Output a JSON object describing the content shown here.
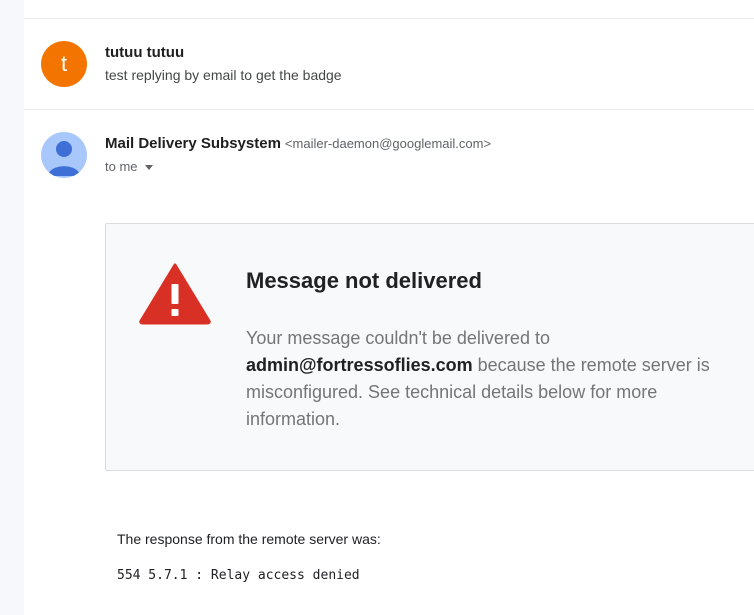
{
  "thread": {
    "previous_message": {
      "avatar_letter": "t",
      "avatar_color": "#f37500",
      "sender": "tutuu tutuu",
      "snippet": "test replying by email to get the badge"
    },
    "message": {
      "sender_name": "Mail Delivery Subsystem",
      "sender_email": "<mailer-daemon@googlemail.com>",
      "recipients": "to me",
      "avatar_icon": "default-user-icon"
    }
  },
  "bounce": {
    "icon": "warning-icon",
    "title": "Message not delivered",
    "body_prefix": "Your message couldn't be delivered to ",
    "email": "admin@fortressoflies.com",
    "body_suffix": " because the remote server is misconfigured. See technical details below for more information."
  },
  "response": {
    "label": "The response from the remote server was:",
    "code": "554 5.7.1 : Relay access denied"
  },
  "colors": {
    "warning_red": "#d93025",
    "card_bg": "#f8f9fa",
    "avatar_blue": "#a8c7fa"
  }
}
